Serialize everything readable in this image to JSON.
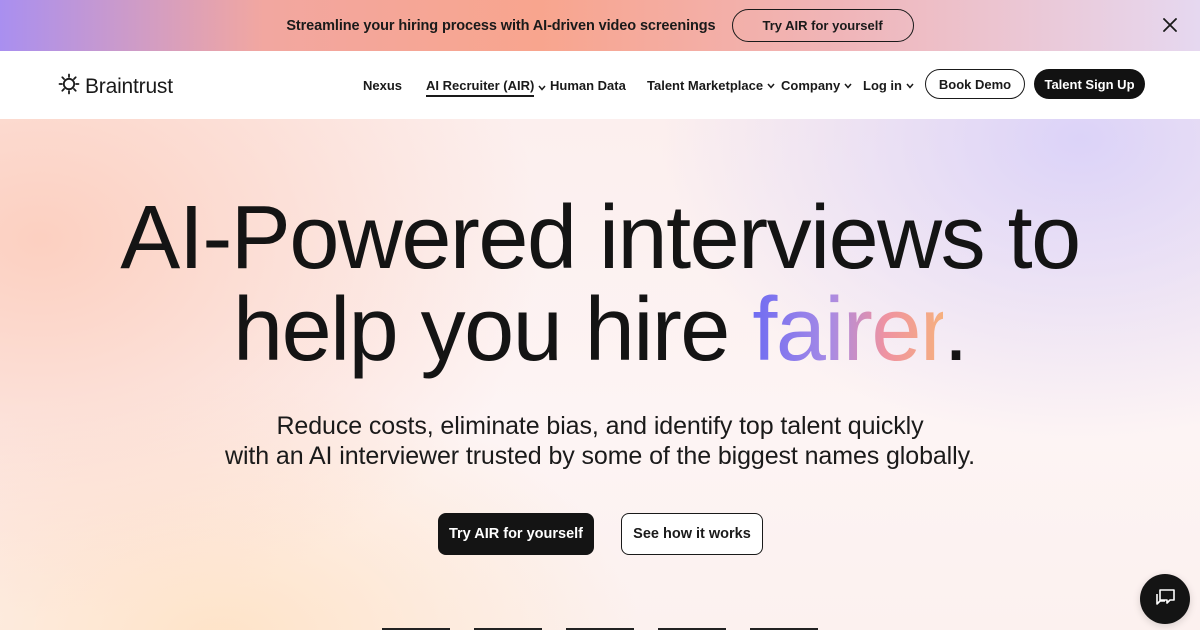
{
  "banner": {
    "text": "Streamline your hiring process with AI-driven video screenings",
    "button_label": "Try AIR for yourself",
    "close_icon": "close-icon"
  },
  "nav": {
    "logo_text": "Braintrust",
    "logo_icon": "sun-gear-icon",
    "items": [
      {
        "label": "Nexus",
        "dropdown": false
      },
      {
        "label": "AI Recruiter (AIR)",
        "dropdown": true,
        "active": true
      },
      {
        "label": "Human Data",
        "dropdown": false
      },
      {
        "label": "Talent Marketplace",
        "dropdown": true
      },
      {
        "label": "Company",
        "dropdown": true
      },
      {
        "label": "Log in",
        "dropdown": true
      }
    ],
    "book_demo_label": "Book Demo",
    "signup_label": "Talent Sign Up"
  },
  "hero": {
    "headline_line1": "AI-Powered interviews to",
    "headline_line2_prefix": "help you hire ",
    "headline_accent": "fairer",
    "headline_suffix": ".",
    "subtitle_line1": "Reduce costs, eliminate bias, and identify top talent quickly",
    "subtitle_line2": "with an AI interviewer trusted by some of the biggest names globally.",
    "primary_cta": "Try AIR for yourself",
    "secondary_cta": "See how it works"
  },
  "colors": {
    "dark": "#141414",
    "accent_gradient": [
      "#6f6cf2",
      "#a68ae6",
      "#ef93a1",
      "#f6b07e"
    ]
  },
  "chat_widget_icon": "chat-bubbles-icon"
}
